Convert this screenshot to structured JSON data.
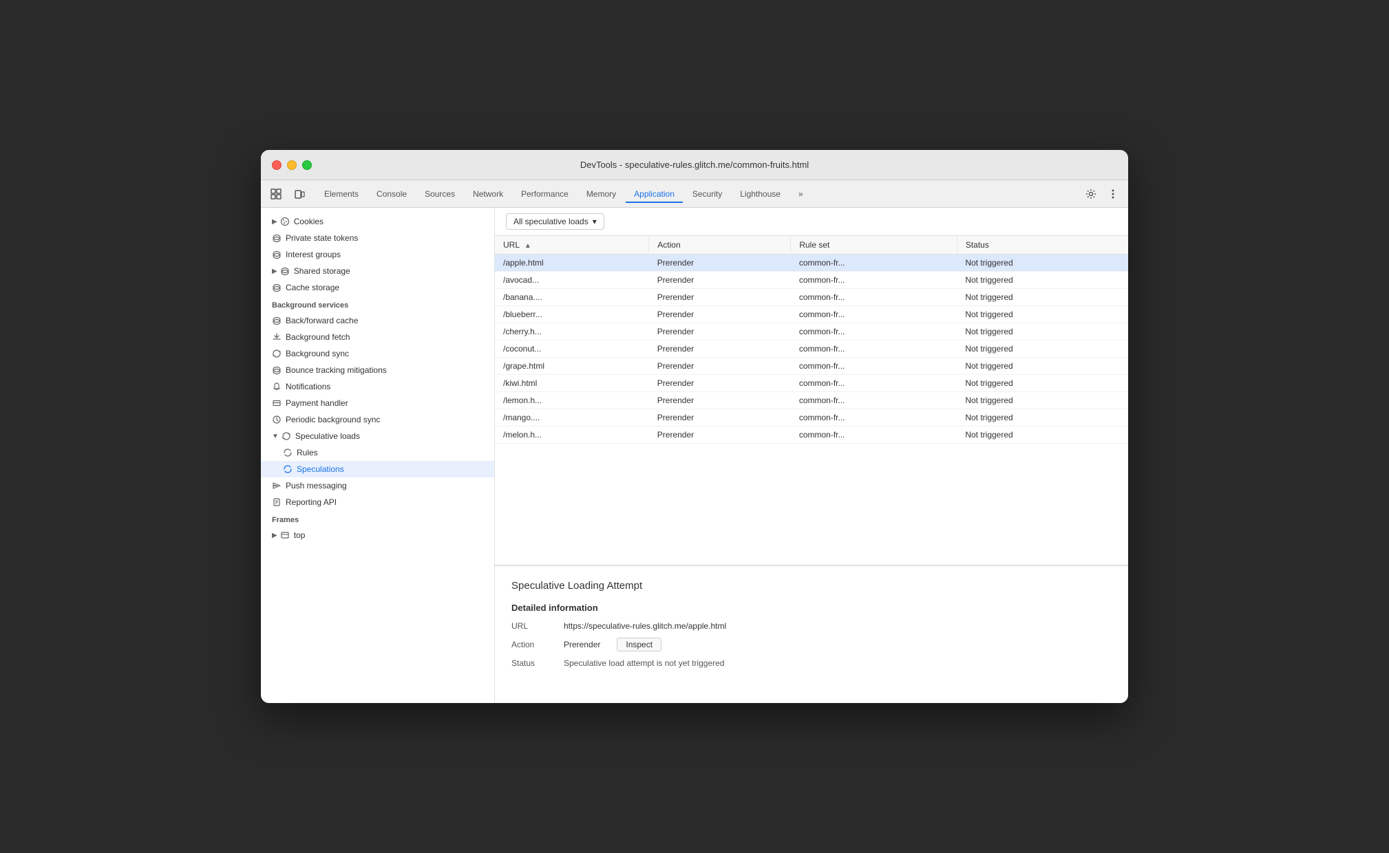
{
  "window": {
    "title": "DevTools - speculative-rules.glitch.me/common-fruits.html"
  },
  "tabs": {
    "items": [
      {
        "label": "Elements",
        "active": false
      },
      {
        "label": "Console",
        "active": false
      },
      {
        "label": "Sources",
        "active": false
      },
      {
        "label": "Network",
        "active": false
      },
      {
        "label": "Performance",
        "active": false
      },
      {
        "label": "Memory",
        "active": false
      },
      {
        "label": "Application",
        "active": true
      },
      {
        "label": "Security",
        "active": false
      },
      {
        "label": "Lighthouse",
        "active": false
      },
      {
        "label": "»",
        "active": false
      }
    ]
  },
  "sidebar": {
    "sections": [
      {
        "name": "storage",
        "items": [
          {
            "label": "Cookies",
            "icon": "arrow-expand",
            "indent": 0,
            "hasArrow": true
          },
          {
            "label": "Private state tokens",
            "icon": "cylinder",
            "indent": 0
          },
          {
            "label": "Interest groups",
            "icon": "cylinder",
            "indent": 0
          },
          {
            "label": "Shared storage",
            "icon": "arrow-expand",
            "indent": 0,
            "hasArrow": true
          },
          {
            "label": "Cache storage",
            "icon": "cylinder",
            "indent": 0
          }
        ]
      },
      {
        "name": "Background services",
        "items": [
          {
            "label": "Back/forward cache",
            "icon": "cylinder",
            "indent": 0
          },
          {
            "label": "Background fetch",
            "icon": "refresh",
            "indent": 0
          },
          {
            "label": "Background sync",
            "icon": "sync",
            "indent": 0
          },
          {
            "label": "Bounce tracking mitigations",
            "icon": "cylinder",
            "indent": 0
          },
          {
            "label": "Notifications",
            "icon": "bell",
            "indent": 0
          },
          {
            "label": "Payment handler",
            "icon": "card",
            "indent": 0
          },
          {
            "label": "Periodic background sync",
            "icon": "clock",
            "indent": 0
          },
          {
            "label": "Speculative loads",
            "icon": "refresh",
            "indent": 0,
            "hasArrow": true,
            "expanded": true
          },
          {
            "label": "Rules",
            "icon": "refresh",
            "indent": 1
          },
          {
            "label": "Speculations",
            "icon": "refresh",
            "indent": 1,
            "active": true
          },
          {
            "label": "Push messaging",
            "icon": "cloud",
            "indent": 0
          },
          {
            "label": "Reporting API",
            "icon": "doc",
            "indent": 0
          }
        ]
      },
      {
        "name": "Frames",
        "items": [
          {
            "label": "top",
            "icon": "frame",
            "indent": 0,
            "hasArrow": true
          }
        ]
      }
    ]
  },
  "filter": {
    "label": "All speculative loads",
    "dropdown_arrow": "▾"
  },
  "table": {
    "columns": [
      {
        "label": "URL",
        "sort": true
      },
      {
        "label": "Action"
      },
      {
        "label": "Rule set"
      },
      {
        "label": "Status"
      }
    ],
    "rows": [
      {
        "url": "/apple.html",
        "action": "Prerender",
        "rule_set": "common-fr...",
        "status": "Not triggered",
        "selected": true
      },
      {
        "url": "/avocad...",
        "action": "Prerender",
        "rule_set": "common-fr...",
        "status": "Not triggered"
      },
      {
        "url": "/banana....",
        "action": "Prerender",
        "rule_set": "common-fr...",
        "status": "Not triggered"
      },
      {
        "url": "/blueberr...",
        "action": "Prerender",
        "rule_set": "common-fr...",
        "status": "Not triggered"
      },
      {
        "url": "/cherry.h...",
        "action": "Prerender",
        "rule_set": "common-fr...",
        "status": "Not triggered"
      },
      {
        "url": "/coconut...",
        "action": "Prerender",
        "rule_set": "common-fr...",
        "status": "Not triggered"
      },
      {
        "url": "/grape.html",
        "action": "Prerender",
        "rule_set": "common-fr...",
        "status": "Not triggered"
      },
      {
        "url": "/kiwi.html",
        "action": "Prerender",
        "rule_set": "common-fr...",
        "status": "Not triggered"
      },
      {
        "url": "/lemon.h...",
        "action": "Prerender",
        "rule_set": "common-fr...",
        "status": "Not triggered"
      },
      {
        "url": "/mango....",
        "action": "Prerender",
        "rule_set": "common-fr...",
        "status": "Not triggered"
      },
      {
        "url": "/melon.h...",
        "action": "Prerender",
        "rule_set": "common-fr...",
        "status": "Not triggered"
      }
    ]
  },
  "detail": {
    "title": "Speculative Loading Attempt",
    "section_title": "Detailed information",
    "url_label": "URL",
    "url_value": "https://speculative-rules.glitch.me/apple.html",
    "action_label": "Action",
    "action_value": "Prerender",
    "inspect_label": "Inspect",
    "status_label": "Status",
    "status_value": "Speculative load attempt is not yet triggered"
  }
}
